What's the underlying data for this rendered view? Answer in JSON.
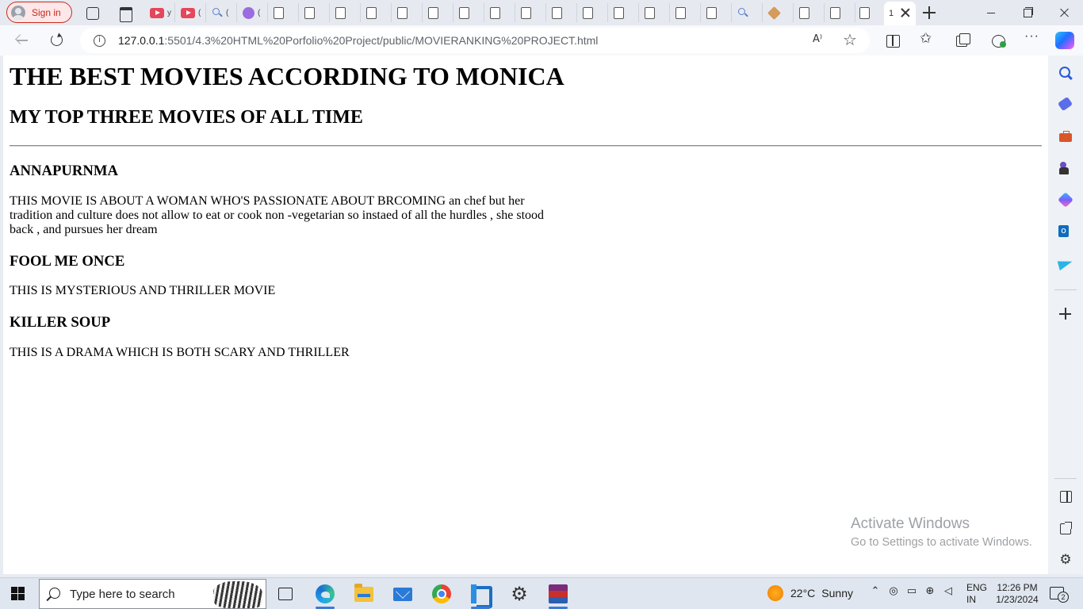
{
  "browser": {
    "profile_label": "Sign in",
    "mini_tabs": [
      {
        "icon": "page-icon",
        "title": "y"
      },
      {
        "icon": "youtube-icon",
        "title": "("
      },
      {
        "icon": "search-icon",
        "title": "("
      },
      {
        "icon": "extension-icon",
        "title": "("
      }
    ],
    "active_tab_title": "1",
    "address": {
      "host": "127.0.0.1",
      "path": ":5501/4.3%20HTML%20Porfolio%20Project/public/MOVIERANKING%20PROJECT.html"
    },
    "more_label": "···"
  },
  "page": {
    "title": "THE BEST MOVIES ACCORDING TO MONICA",
    "subtitle": "MY TOP THREE MOVIES OF ALL TIME",
    "movies": [
      {
        "title": "ANNAPURNMA",
        "description": "THIS MOVIE IS ABOUT A WOMAN WHO'S PASSIONATE ABOUT BRCOMING an chef but her tradition and culture does not allow to eat or cook non -vegetarian so instaed of all the hurdles , she stood back , and pursues her dream"
      },
      {
        "title": "FOOL ME ONCE",
        "description": "THIS IS MYSTERIOUS AND THRILLER MOVIE"
      },
      {
        "title": "KILLER SOUP",
        "description": "THIS IS A DRAMA WHICH IS BOTH SCARY AND THRILLER"
      }
    ]
  },
  "watermark": {
    "line1": "Activate Windows",
    "line2": "Go to Settings to activate Windows."
  },
  "taskbar": {
    "search_placeholder": "Type here to search",
    "weather": {
      "temp": "22°C",
      "condition": "Sunny"
    },
    "language": {
      "line1": "ENG",
      "line2": "IN"
    },
    "clock": {
      "time": "12:26 PM",
      "date": "1/23/2024"
    },
    "notification_count": "2"
  },
  "colors": {
    "accent": "#3b78d8",
    "signin_red": "#c42b1c",
    "watermark": "#9ea1a5"
  }
}
